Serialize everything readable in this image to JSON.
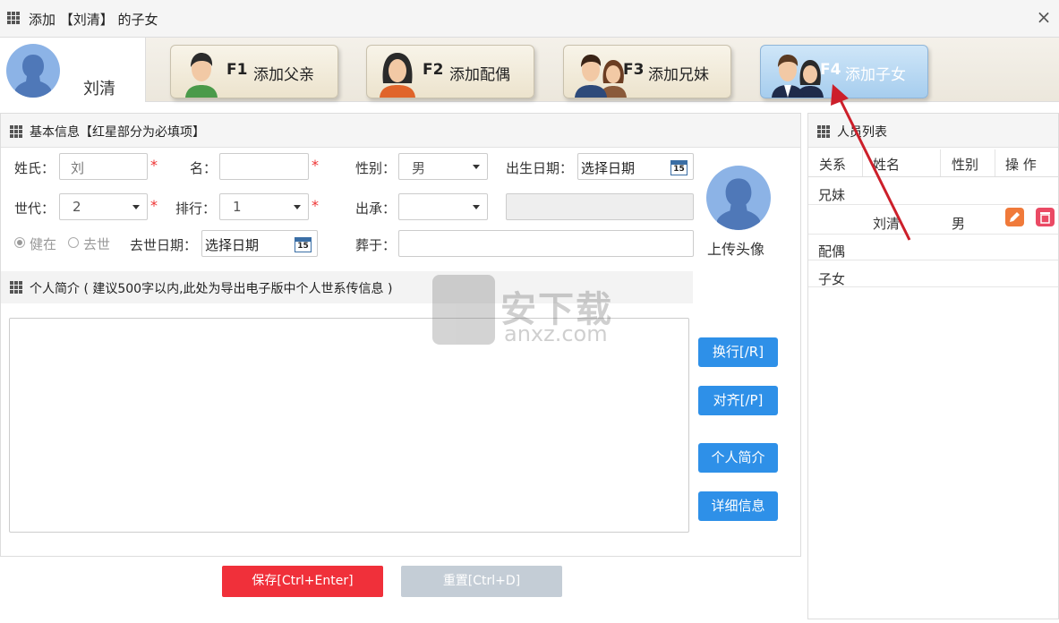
{
  "window": {
    "title": "添加 【刘清】 的子女",
    "close_glyph": "×"
  },
  "person": {
    "name": "刘清",
    "avatar_icon": "person-silhouette-icon"
  },
  "banner_buttons": [
    {
      "key": "F1",
      "label": "添加父亲",
      "icon": "father-icon",
      "active": false
    },
    {
      "key": "F2",
      "label": "添加配偶",
      "icon": "spouse-icon",
      "active": false
    },
    {
      "key": "F3",
      "label": "添加兄妹",
      "icon": "siblings-icon",
      "active": false
    },
    {
      "key": "F4",
      "label": "添加子女",
      "icon": "children-icon",
      "active": true
    }
  ],
  "basic": {
    "title": "基本信息【红星部分为必填项】",
    "surname": {
      "label": "姓氏：",
      "value": "刘"
    },
    "given_name": {
      "label": "名：",
      "value": ""
    },
    "gender": {
      "label": "性别：",
      "value": "男"
    },
    "birth_date": {
      "label": "出生日期：",
      "placeholder": "选择日期"
    },
    "generation": {
      "label": "世代：",
      "value": "2"
    },
    "rank": {
      "label": "排行：",
      "value": "1"
    },
    "inherit": {
      "label": "出承：",
      "value": ""
    },
    "status": {
      "options": [
        "健在",
        "去世"
      ],
      "selected": "健在"
    },
    "death_date": {
      "label": "去世日期：",
      "placeholder": "选择日期"
    },
    "burial": {
      "label": "葬于：",
      "value": ""
    },
    "calendar_day": "15",
    "required_mark": "*",
    "upload_label": "上传头像"
  },
  "bio": {
    "title": "个人简介 ( 建议500字以内,此处为导出电子版中个人世系传信息 )",
    "value": ""
  },
  "side_buttons": [
    {
      "label": "换行[/R]"
    },
    {
      "label": "对齐[/P]"
    },
    {
      "label": "个人简介"
    },
    {
      "label": "详细信息"
    }
  ],
  "actions": {
    "save": "保存[Ctrl+Enter]",
    "reset": "重置[Ctrl+D]"
  },
  "watermark": {
    "cn": "安下载",
    "en": "anxz.com"
  },
  "people_list": {
    "title": "人员列表",
    "columns": [
      "关系",
      "姓名",
      "性别",
      "操 作"
    ],
    "groups": [
      {
        "label": "兄妹",
        "rows": [
          {
            "name": "刘清",
            "gender": "男"
          }
        ]
      },
      {
        "label": "配偶",
        "rows": []
      },
      {
        "label": "子女",
        "rows": []
      }
    ],
    "row_actions": [
      "edit-icon",
      "delete-icon"
    ]
  },
  "colors": {
    "accent_blue": "#2e90e8",
    "save_red": "#f0303a",
    "reset_gray": "#c4cdd6",
    "required_red": "#ee3333",
    "annotation_arrow": "#cc1f2a"
  }
}
